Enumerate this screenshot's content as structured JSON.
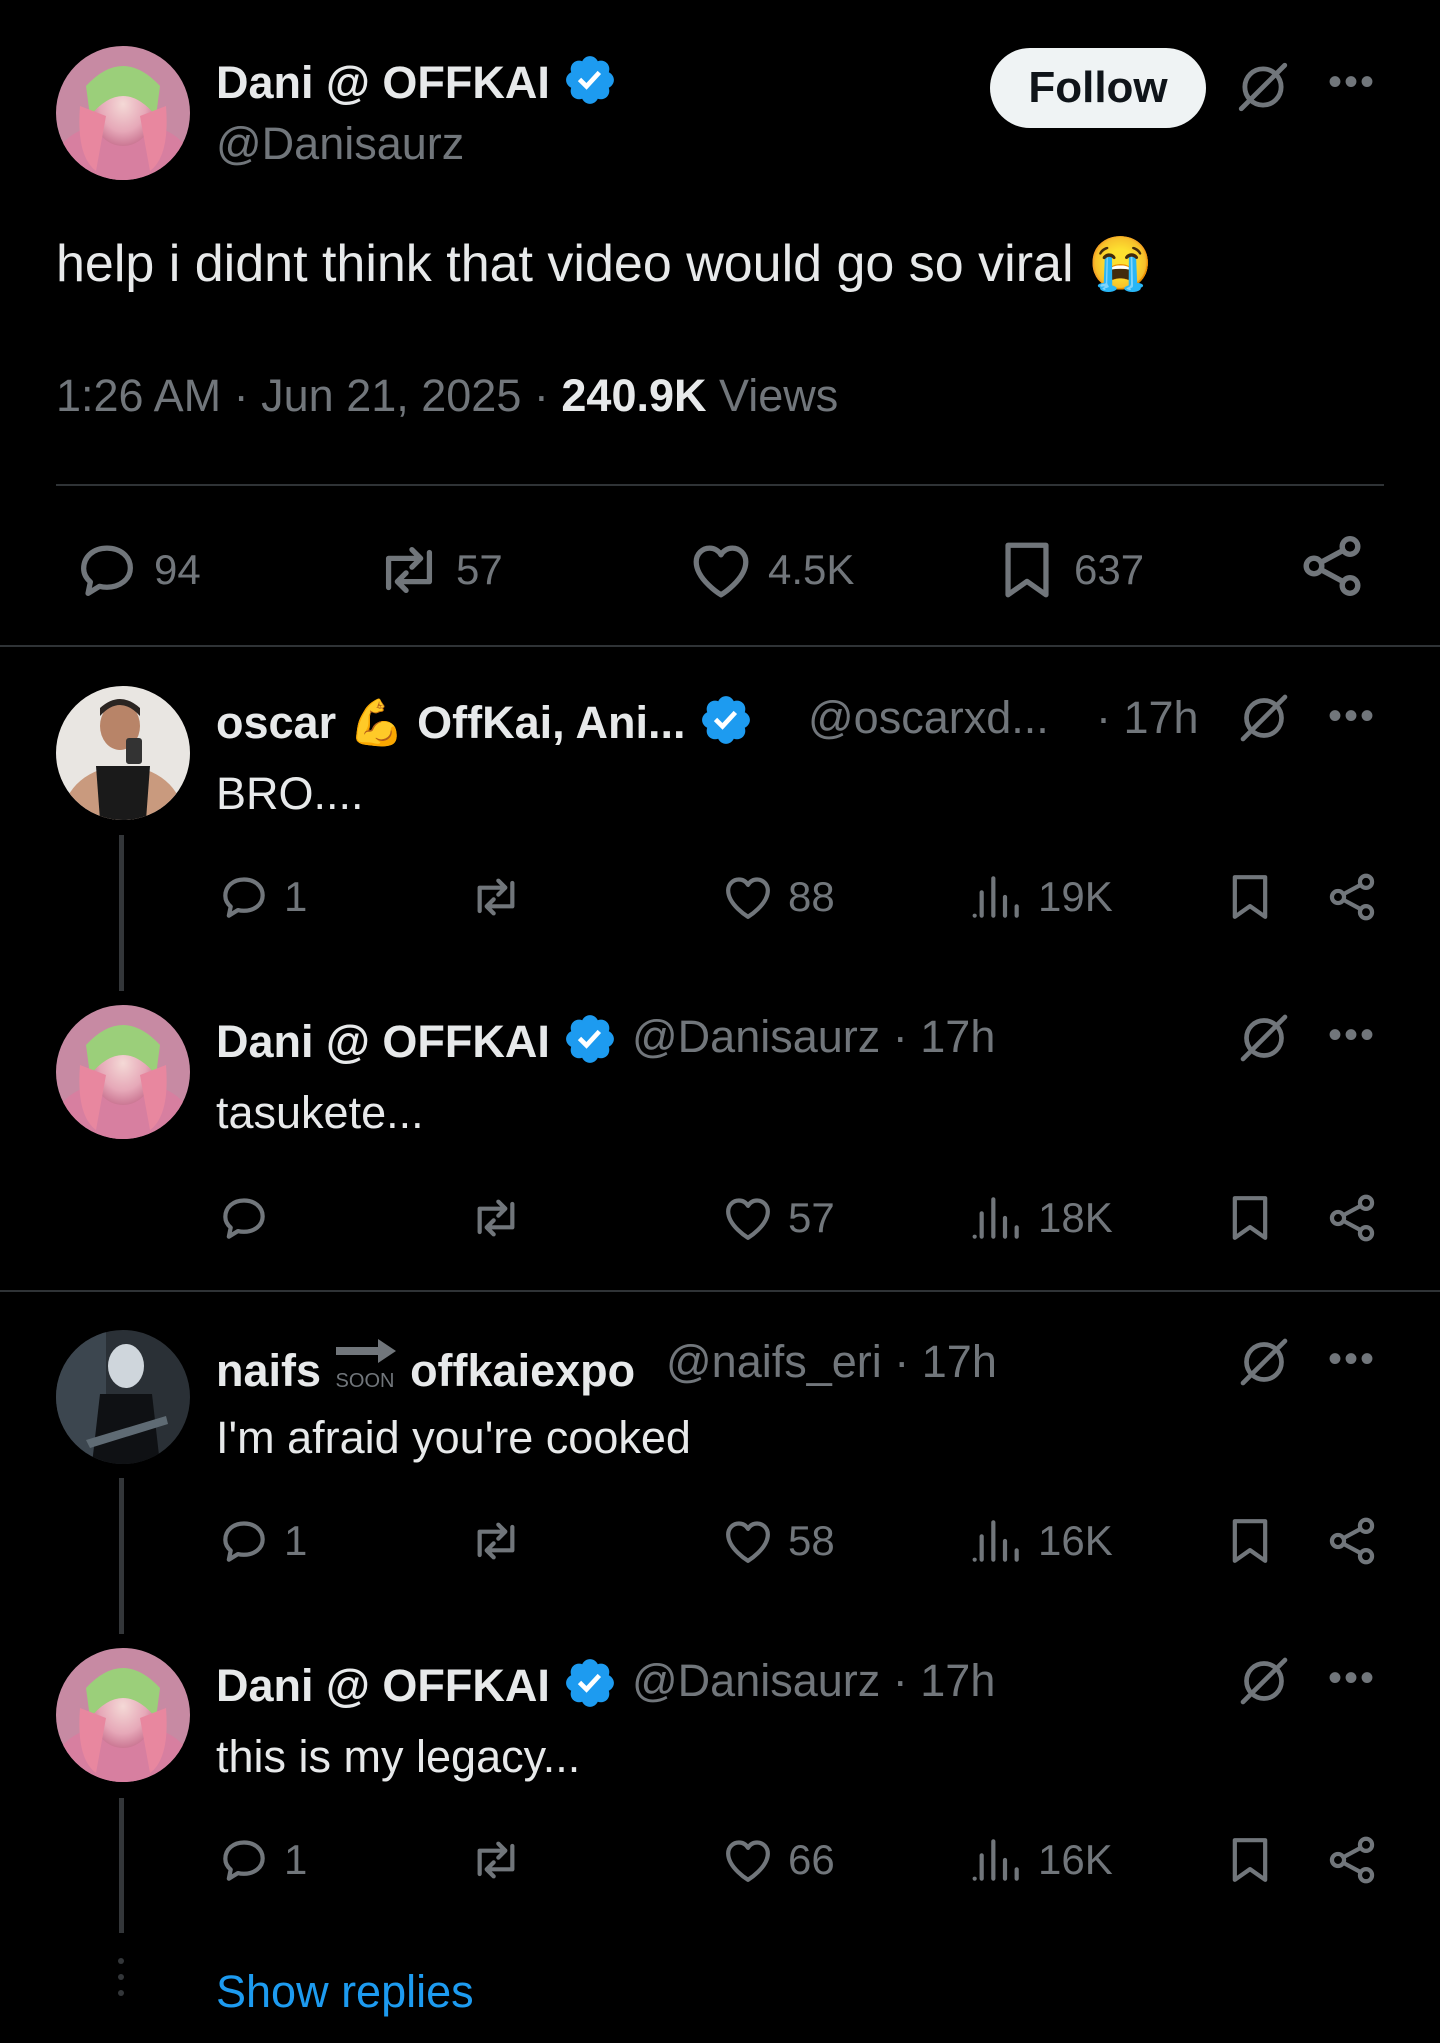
{
  "main_post": {
    "author_name": "Dani @ OFFKAI",
    "handle": "@Danisaurz",
    "follow_label": "Follow",
    "text": "help i didnt think that video would go so viral",
    "emoji": "😭",
    "time": "1:26 AM",
    "date": "Jun 21, 2025",
    "views_count": "240.9K",
    "views_label": "Views",
    "replies": "94",
    "reposts": "57",
    "likes": "4.5K",
    "bookmarks": "637"
  },
  "replies": [
    {
      "author_name": "oscar",
      "author_name_emoji": "💪",
      "author_name_suffix": "OffKai, Ani...",
      "handle": "@oscarxd...",
      "time": "· 17h",
      "text": "BRO....",
      "replies": "1",
      "reposts": "",
      "likes": "88",
      "views": "19K"
    },
    {
      "author_name": "Dani @ OFFKAI",
      "handle": "@Danisaurz",
      "time": "· 17h",
      "text": "tasukete...",
      "replies": "",
      "reposts": "",
      "likes": "57",
      "views": "18K"
    },
    {
      "author_name": "naifs",
      "author_name_badge": "SOON",
      "author_name_suffix": "offkaiexpo",
      "handle": "@naifs_eri",
      "time": "· 17h",
      "text": "I'm afraid you're cooked",
      "replies": "1",
      "reposts": "",
      "likes": "58",
      "views": "16K"
    },
    {
      "author_name": "Dani @ OFFKAI",
      "handle": "@Danisaurz",
      "time": "· 17h",
      "text": "this is my legacy...",
      "replies": "1",
      "reposts": "",
      "likes": "66",
      "views": "16K"
    }
  ],
  "show_replies_label": "Show replies",
  "colors": {
    "background": "#000000",
    "text": "#e7e9ea",
    "secondary": "#71767b",
    "verified": "#1d9bf0",
    "link": "#1d9bf0"
  }
}
